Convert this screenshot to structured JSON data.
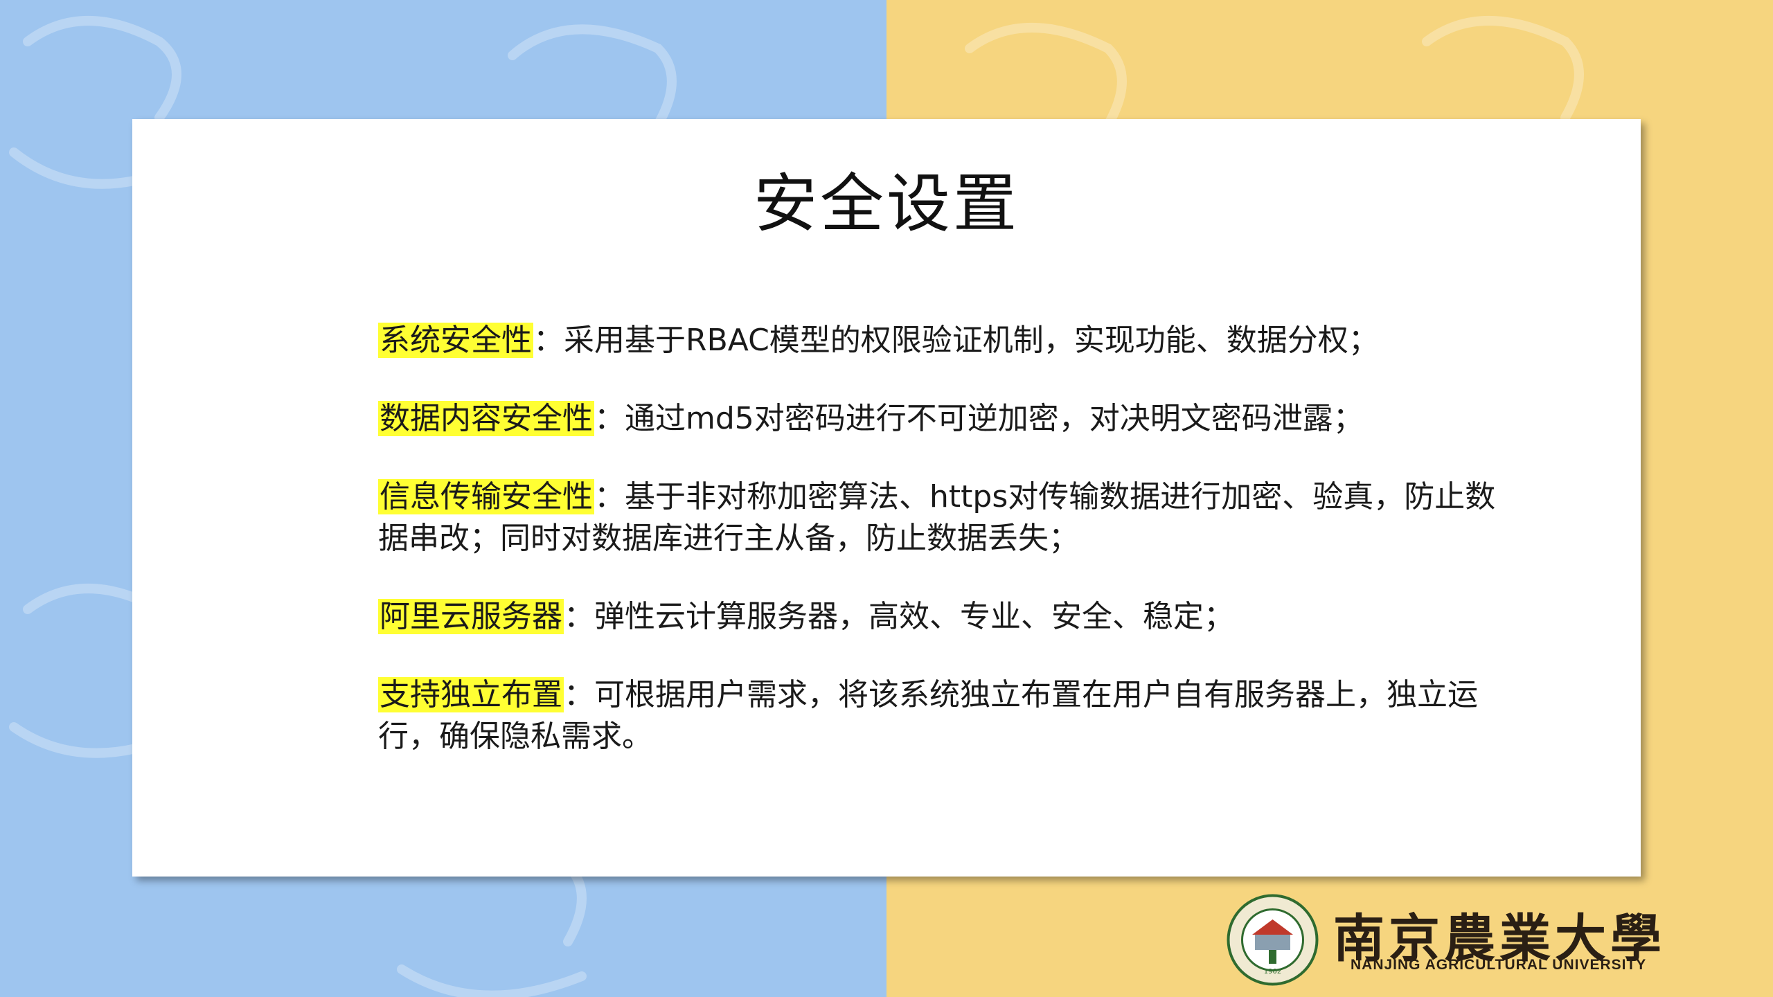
{
  "slide": {
    "title": "安全设置",
    "items": [
      {
        "label": "系统安全性",
        "text": "：采用基于RBAC模型的权限验证机制，实现功能、数据分权；"
      },
      {
        "label": "数据内容安全性",
        "text": "：通过md5对密码进行不可逆加密，对决明文密码泄露；"
      },
      {
        "label": "信息传输安全性",
        "text": "：基于非对称加密算法、https对传输数据进行加密、验真，防止数据串改；同时对数据库进行主从备，防止数据丢失；"
      },
      {
        "label": "阿里云服务器",
        "text": "：弹性云计算服务器，高效、专业、安全、稳定；"
      },
      {
        "label": "支持独立布置",
        "text": "：可根据用户需求，将该系统独立布置在用户自有服务器上，独立运行，确保隐私需求。"
      }
    ]
  },
  "footer": {
    "university_cn": "南京農業大學",
    "university_en": "NANJING AGRICULTURAL UNIVERSITY",
    "seal_year": "1902"
  },
  "watermark": {
    "text": "南京农业大学"
  },
  "colors": {
    "left_bg": "#9ec5ef",
    "right_bg": "#f6d57f",
    "highlight": "#ffff33"
  }
}
